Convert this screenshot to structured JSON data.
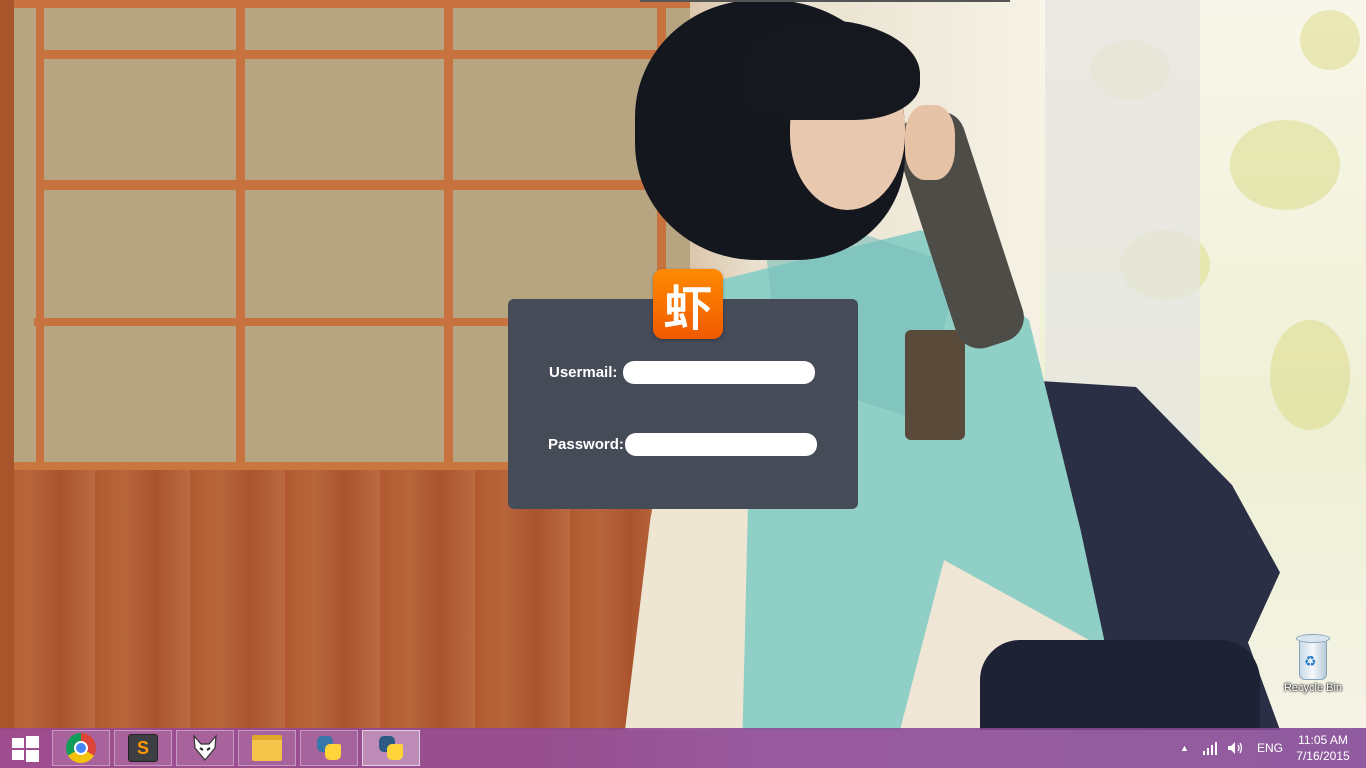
{
  "login": {
    "logo_char": "虾",
    "usermail_label": "Usermail:",
    "usermail_value": "",
    "password_label": "Password:",
    "password_value": ""
  },
  "desktop": {
    "recycle_bin_label": "Recycle Bin"
  },
  "taskbar": {
    "apps": [
      {
        "name": "chrome",
        "icon": "chrome-icon"
      },
      {
        "name": "sublime-text",
        "icon": "sublime-text-icon",
        "glyph": "S"
      },
      {
        "name": "foobar2000",
        "icon": "foobar-icon"
      },
      {
        "name": "file-explorer",
        "icon": "folder-icon"
      },
      {
        "name": "python-idle",
        "icon": "python-icon"
      },
      {
        "name": "python-app",
        "icon": "python-window-icon"
      }
    ],
    "tray": {
      "language": "ENG",
      "time": "11:05 AM",
      "date": "7/16/2015"
    }
  },
  "colors": {
    "panel_bg": "#464b58",
    "logo_orange": "#f26d00",
    "taskbar": "#8e4a96"
  }
}
